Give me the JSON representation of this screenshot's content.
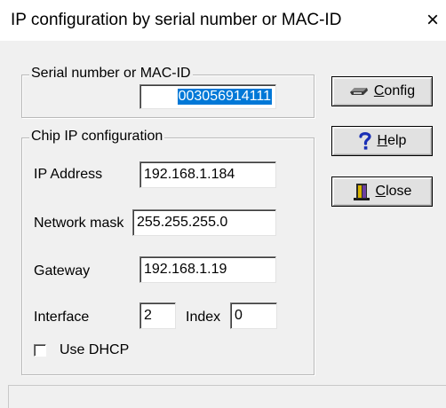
{
  "window": {
    "title": "IP configuration by serial number or MAC-ID",
    "close_glyph": "×"
  },
  "serial_group": {
    "legend": "Serial number or MAC-ID",
    "value": "003056914111"
  },
  "chip_group": {
    "legend": "Chip IP configuration",
    "ip_label": "IP Address",
    "ip_value": "192.168.1.184",
    "mask_label": "Network mask",
    "mask_value": "255.255.255.0",
    "gateway_label": "Gateway",
    "gateway_value": "192.168.1.19",
    "interface_label": "Interface",
    "interface_value": "2",
    "index_label": "Index",
    "index_value": "0",
    "dhcp_label": "Use DHCP",
    "dhcp_checked": false
  },
  "buttons": {
    "config": {
      "mnemonic": "C",
      "rest": "onfig",
      "icon": "config-icon"
    },
    "help": {
      "mnemonic": "H",
      "rest": "elp",
      "icon": "help-icon"
    },
    "close": {
      "mnemonic": "C",
      "rest": "lose",
      "icon": "close-door-icon"
    }
  },
  "colors": {
    "selection": "#0078d7",
    "help_icon": "#1a2fb5",
    "dialog_bg": "#f0f0f0"
  }
}
